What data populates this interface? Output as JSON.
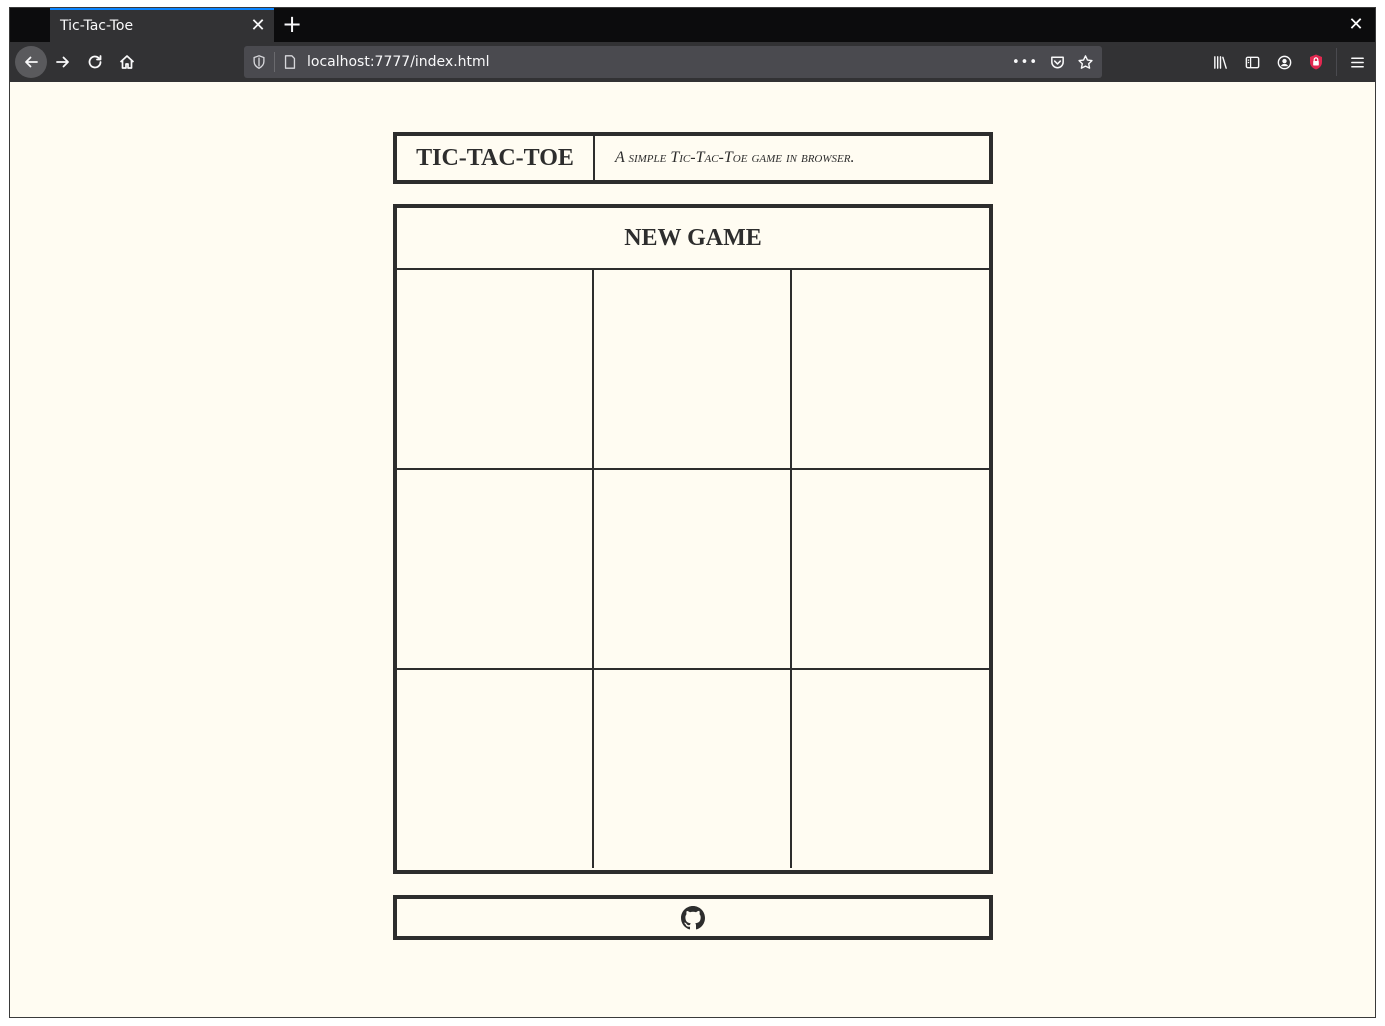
{
  "browser": {
    "tab": {
      "title": "Tic-Tac-Toe",
      "close_glyph": "✕"
    },
    "new_tab_glyph": "+",
    "window_close_glyph": "✕",
    "url": "localhost:7777/index.html",
    "url_more_glyph": "•••",
    "accent_color": "#0a84ff"
  },
  "page": {
    "title": "TIC-TAC-TOE",
    "subtitle": "A simple Tic-Tac-Toe game in browser.",
    "new_game_label": "NEW GAME",
    "board": [
      "",
      "",
      "",
      "",
      "",
      "",
      "",
      "",
      ""
    ],
    "footer_icon": "github-icon",
    "background_color": "#fffcf2",
    "ink_color": "#2d2d2d"
  }
}
